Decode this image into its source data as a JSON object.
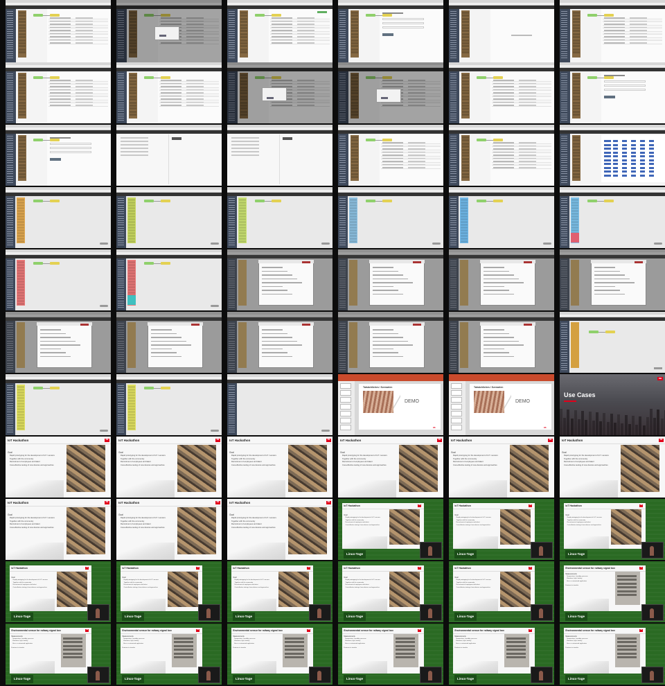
{
  "rows": [
    {
      "kind": "nodered",
      "tiles": [
        {
          "v": "list"
        },
        {
          "v": "dialog-small"
        },
        {
          "v": "list-green"
        },
        {
          "v": "form"
        },
        {
          "v": "blank"
        },
        {
          "v": "list"
        }
      ]
    },
    {
      "kind": "nodered",
      "tiles": [
        {
          "v": "list"
        },
        {
          "v": "list"
        },
        {
          "v": "list-dim-dialog"
        },
        {
          "v": "dialog-small"
        },
        {
          "v": "list"
        },
        {
          "v": "form"
        }
      ]
    },
    {
      "kind": "nodered",
      "tiles": [
        {
          "v": "form"
        },
        {
          "v": "settings"
        },
        {
          "v": "settings"
        },
        {
          "v": "list"
        },
        {
          "v": "list"
        },
        {
          "v": "bluegrid"
        }
      ]
    },
    {
      "kind": "flow",
      "tiles": [
        {
          "v": "flow",
          "palette": "#e0a850"
        },
        {
          "v": "flow",
          "palette": "#c8d860"
        },
        {
          "v": "flow",
          "palette": "#c8e070"
        },
        {
          "v": "flow",
          "palette": "#8cc0e0"
        },
        {
          "v": "flow",
          "palette": "#70b8e8"
        },
        {
          "v": "flow",
          "palette": "#7cc0e8",
          "accent": "#e06070"
        }
      ]
    },
    {
      "kind": "flow",
      "tiles": [
        {
          "v": "flow",
          "palette": "#e87878"
        },
        {
          "v": "flow",
          "palette": "#e87878",
          "accent": "#40c0c0"
        },
        {
          "v": "modal"
        },
        {
          "v": "modal"
        },
        {
          "v": "modal"
        },
        {
          "v": "modal"
        }
      ]
    },
    {
      "kind": "flow",
      "tiles": [
        {
          "v": "modal"
        },
        {
          "v": "modal"
        },
        {
          "v": "modal"
        },
        {
          "v": "modal"
        },
        {
          "v": "modal"
        },
        {
          "v": "flow-orange"
        }
      ]
    },
    {
      "kind": "mixed",
      "tiles": [
        {
          "v": "flow",
          "palette": "#e0e060"
        },
        {
          "v": "flow",
          "palette": "#e0e060"
        },
        {
          "v": "flow-blank"
        },
        {
          "v": "slide-demo"
        },
        {
          "v": "slide-demo"
        },
        {
          "v": "usecases"
        }
      ]
    },
    {
      "kind": "slides",
      "tiles": [
        {
          "v": "iot"
        },
        {
          "v": "iot"
        },
        {
          "v": "iot"
        },
        {
          "v": "iot"
        },
        {
          "v": "iot"
        },
        {
          "v": "iot"
        }
      ]
    },
    {
      "kind": "slides",
      "tiles": [
        {
          "v": "iot"
        },
        {
          "v": "iot"
        },
        {
          "v": "iot"
        },
        {
          "v": "iot-lt"
        },
        {
          "v": "iot-lt"
        },
        {
          "v": "iot-lt"
        }
      ]
    },
    {
      "kind": "slides",
      "tiles": [
        {
          "v": "iot-lt"
        },
        {
          "v": "iot-lt"
        },
        {
          "v": "iot-lt"
        },
        {
          "v": "iot-lt"
        },
        {
          "v": "iot-lt"
        },
        {
          "v": "env-lt"
        }
      ]
    },
    {
      "kind": "slides",
      "tiles": [
        {
          "v": "env-lt"
        },
        {
          "v": "env-lt"
        },
        {
          "v": "env-lt"
        },
        {
          "v": "env-lt"
        },
        {
          "v": "env-lt"
        },
        {
          "v": "env-lt"
        }
      ]
    }
  ],
  "slide_text": {
    "iot_title": "IoT Hackathon",
    "env_title": "Environmental sensor for railway signal box",
    "demo_label": "DEMO",
    "demo_heading": "Tatsächliches / Szenarien",
    "usecases_title": "Use Cases",
    "db_logo": "DB",
    "linuxtage_logo": "Linux-Tage",
    "iot_goal": "Goal",
    "iot_bullets": [
      "Rapid prototyping for the development of IoT / sensors",
      "Together with the community",
      "Recruitment of employees and talent",
      "Cost-effective testing of new devices and approaches"
    ],
    "env_measurements": "Measurements",
    "env_bullets": [
      "Temperature, humidity, pressure",
      "Vibrations, light, battery",
      "Uses a customized application"
    ],
    "env_footer": "Features to transfer"
  },
  "colors": {
    "background": "#0c0c0c",
    "sidebar": "#3f4a5c",
    "db_red": "#e2001a",
    "linuxtage_green": "#2a6a23",
    "node_yellow": "#e3d152",
    "node_green": "#8fd06b"
  }
}
